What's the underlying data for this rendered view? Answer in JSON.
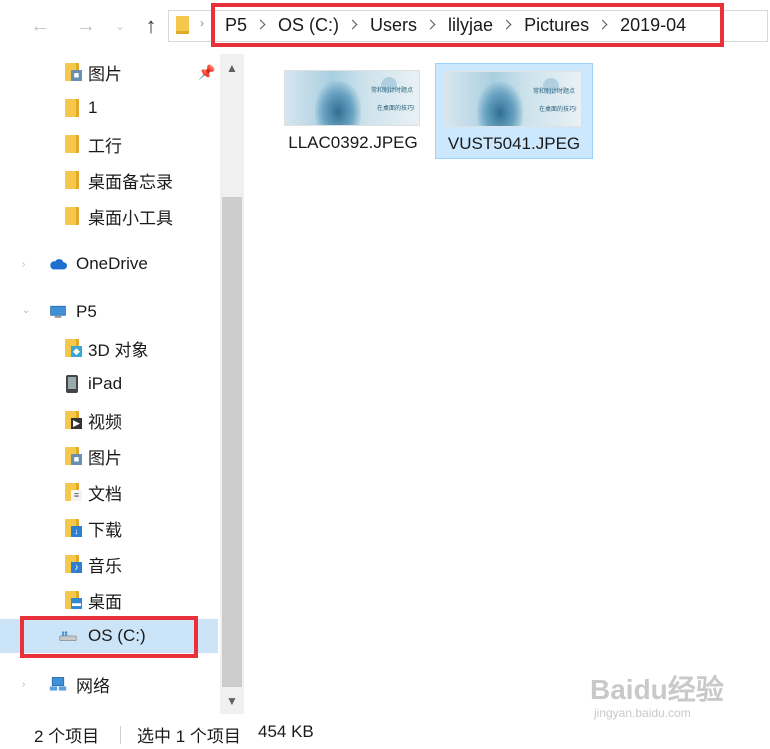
{
  "address_bar": {
    "breadcrumbs": [
      "P5",
      "OS (C:)",
      "Users",
      "lilyjae",
      "Pictures",
      "2019-04"
    ]
  },
  "nav_pane": {
    "quick_access": [
      {
        "label": "图片",
        "icon": "pictures-folder-icon",
        "pinned": true
      },
      {
        "label": "1",
        "icon": "folder-icon"
      },
      {
        "label": "工行",
        "icon": "folder-icon"
      },
      {
        "label": "桌面备忘录",
        "icon": "folder-icon"
      },
      {
        "label": "桌面小工具",
        "icon": "folder-icon"
      }
    ],
    "onedrive": {
      "label": "OneDrive",
      "icon": "cloud-icon"
    },
    "this_pc": {
      "label": "P5",
      "icon": "computer-icon"
    },
    "this_pc_items": [
      {
        "label": "3D 对象",
        "icon": "3d-objects-folder-icon"
      },
      {
        "label": "iPad",
        "icon": "ipad-icon"
      },
      {
        "label": "视频",
        "icon": "videos-folder-icon"
      },
      {
        "label": "图片",
        "icon": "pictures-folder-icon"
      },
      {
        "label": "文档",
        "icon": "documents-folder-icon"
      },
      {
        "label": "下载",
        "icon": "downloads-folder-icon"
      },
      {
        "label": "音乐",
        "icon": "music-folder-icon"
      },
      {
        "label": "桌面",
        "icon": "desktop-folder-icon"
      },
      {
        "label": "OS (C:)",
        "icon": "drive-icon",
        "selected": true
      }
    ],
    "network": {
      "label": "网络",
      "icon": "network-icon"
    }
  },
  "files": [
    {
      "name": "LLAC0392.JPEG",
      "selected": false,
      "thumb_text": [
        "常和别计时题点",
        "在桌面的技巧!"
      ]
    },
    {
      "name": "VUST5041.JPEG",
      "selected": true,
      "thumb_text": [
        "常和别计时题点",
        "在桌面的技巧!"
      ]
    }
  ],
  "status_bar": {
    "item_count": "2 个项目",
    "selection": "选中 1 个项目",
    "size": "454 KB"
  },
  "watermark": {
    "brand": "Baidu经验",
    "url": "jingyan.baidu.com"
  },
  "colors": {
    "highlight": "#e8313a",
    "selection_bg": "#cce8ff",
    "folder": "#f5c74a"
  }
}
